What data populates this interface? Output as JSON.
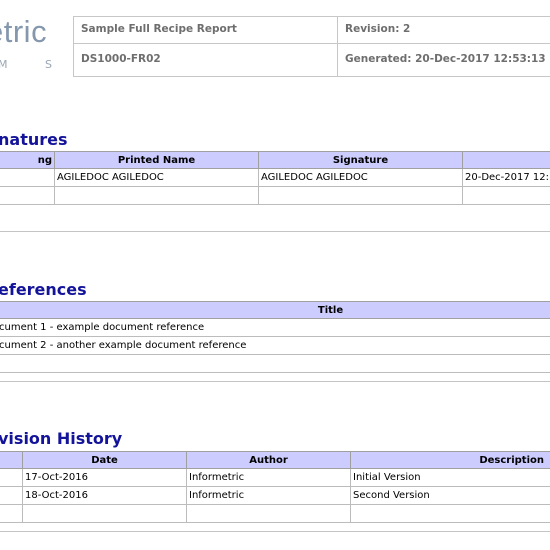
{
  "logo": {
    "text": "etric",
    "sub": "M S"
  },
  "header": {
    "report_title": "Sample Full Recipe Report",
    "revision": "Revision: 2",
    "doc_id": "DS1000-FR02",
    "generated": "Generated: 20-Dec-2017 12:53:13"
  },
  "signatures": {
    "title": "natures",
    "columns": [
      "ng",
      "Printed Name",
      "Signature",
      ""
    ],
    "rows": [
      [
        "",
        "AGILEDOC AGILEDOC",
        "AGILEDOC AGILEDOC",
        "20-Dec-2017 12:"
      ]
    ]
  },
  "references": {
    "title": "eferences",
    "columns": [
      "Title"
    ],
    "rows": [
      [
        "cument 1 - example document reference"
      ],
      [
        "cument 2 - another example document reference"
      ]
    ]
  },
  "revision_history": {
    "title": "vision History",
    "columns": [
      "",
      "Date",
      "Author",
      "Description"
    ],
    "rows": [
      [
        "",
        "17-Oct-2016",
        "Informetric",
        "Initial Version"
      ],
      [
        "",
        "18-Oct-2016",
        "Informetric",
        "Second Version"
      ]
    ]
  }
}
